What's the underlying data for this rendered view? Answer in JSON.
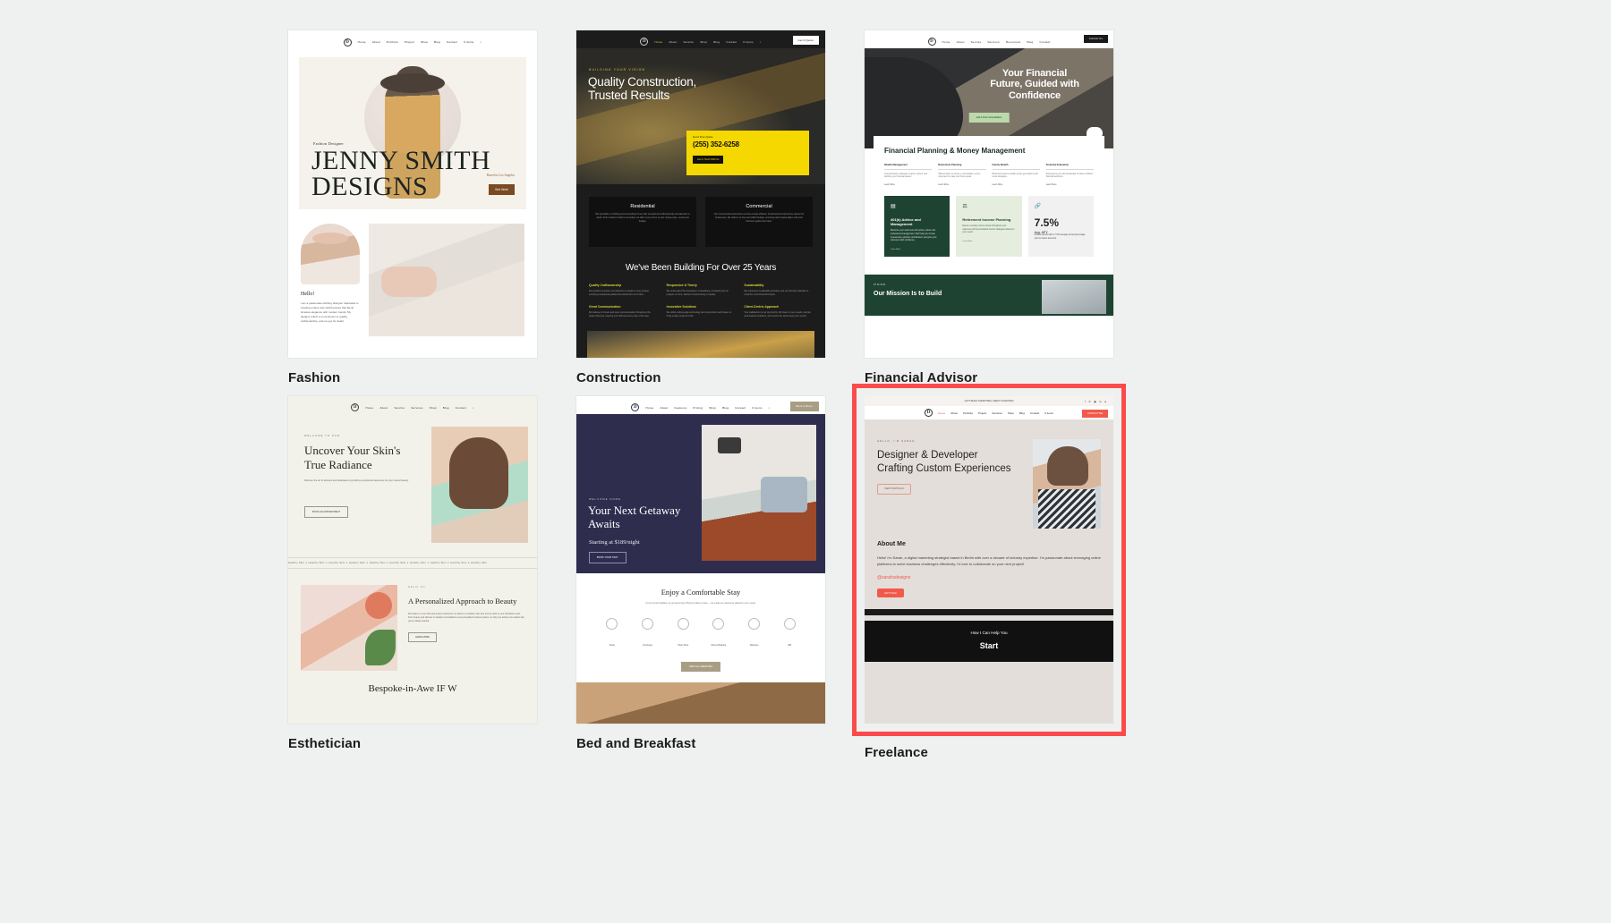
{
  "page": {
    "background": "#eff0f0",
    "highlight_color": "#fb4b4b"
  },
  "cards": [
    {
      "label": "Fashion",
      "nav": {
        "logo": "D",
        "items": [
          "Home",
          "About",
          "Portfolio",
          "Project",
          "Shop",
          "Blog",
          "Contact"
        ],
        "cart": "0 items",
        "search": "search-icon"
      },
      "hero": {
        "eyebrow": "Fashion Designer",
        "title_line1": "JENNY SMITH",
        "title_line2": "DESIGNS",
        "location": "Based in Los Angeles",
        "button": "See Work"
      },
      "about": {
        "heading": "Hello!",
        "body": "I am a passionate clothing designer dedicated to creating unique and stylish pieces that blend timeless elegance with modern trends. My designs reflect a commitment to quality, craftsmanship, and an eye for detail."
      }
    },
    {
      "label": "Construction",
      "nav": {
        "logo": "D",
        "items": [
          "Home",
          "About",
          "Service",
          "Shop",
          "Blog",
          "Contact"
        ],
        "cart": "0 items",
        "quote_button": "Get A Quote"
      },
      "hero": {
        "eyebrow": "BUILDING YOUR VISION",
        "title_line1": "Quality Construction,",
        "title_line2": "Trusted Results",
        "quote_label": "Get A Free Quote",
        "phone": "(255) 352-6258",
        "cta": "Get In Touch With Us"
      },
      "services": [
        {
          "title": "Residential",
          "body": "We specialize in building and renovating homes with exceptional craftsmanship and attention to detail. From modern builds to remodels, we tailor every home to your unique style, needs and budget."
        },
        {
          "title": "Commercial",
          "body": "Our commercial construction services create efficient, functional and impressive spaces for businesses. We deliver on time and within budget, ensuring each project aligns with your business goals and brand."
        }
      ],
      "years_heading": "We've Been Building For Over 25 Years",
      "features": [
        {
          "title": "Quality Craftsmanship",
          "body": "We prioritize precision and attention to detail in every project, ensuring exceptional quality that stands the test of time."
        },
        {
          "title": "Responsive & Timely",
          "body": "We understand the importance of deadlines, completing all our projects on time, without compromising on quality."
        },
        {
          "title": "Sustainability",
          "body": "We implement sustainable practices and eco friendly materials to minimize environmental impact."
        },
        {
          "title": "Great Communication",
          "body": "We believe in honest and open communication throughout the project lifecycle, keeping you informed every step of the way."
        },
        {
          "title": "Innovative Solutions",
          "body": "We utilize cutting edge technology and construction techniques to bring unique projects to life."
        },
        {
          "title": "Client-Centric Approach",
          "body": "Your satisfaction is our top priority. We listen to your needs, provide personalized solutions, and ensure the work meets your needs."
        }
      ]
    },
    {
      "label": "Financial Advisor",
      "nav": {
        "logo": "D",
        "items": [
          "Home",
          "About",
          "Service",
          "Services",
          "Resources",
          "Blog",
          "Contact"
        ],
        "contact_button": "Contact Us"
      },
      "hero": {
        "title_line1": "Your Financial",
        "title_line2": "Future, Guided with",
        "title_line3": "Confidence",
        "button": "Get A Free Consultation"
      },
      "panel": {
        "title": "Financial Planning & Money Management",
        "columns": [
          {
            "title": "Wealth Management",
            "body": "Comprehensive strategies to grow, protect, and optimize your financial assets.",
            "link": "Learn More"
          },
          {
            "title": "Retirement Planning",
            "body": "Tailored plans to ensure a comfortable, secure retirement to make your future goals.",
            "link": "Learn More"
          },
          {
            "title": "Family Wealth",
            "body": "Build and preserve wealth across generations with smart strategies.",
            "link": "Learn More"
          },
          {
            "title": "Financial Education",
            "body": "Empowering you with knowledge to make confident financial decisions.",
            "link": "Learn More"
          }
        ],
        "tiles": [
          {
            "icon": "document-icon",
            "title": "401(k) Advice and Management",
            "body": "Maximize your retirement with advice, advice and professional management. We'll help you choose investments, optimize contributions, and grow your retirement with confidence.",
            "link": "Learn More"
          },
          {
            "icon": "handshake-icon",
            "title": "Retirement Income Planning",
            "body": "Ensure a steady income stream throughout your retirement with personalized income strategies tailored to your needs.",
            "link": "Learn More"
          },
          {
            "icon": "link-icon",
            "big": "7.5%",
            "sub": "Avg. APY",
            "body": "Achieve growth with a 7.5% average annual percentage yield on select accounts."
          }
        ]
      },
      "footer": {
        "eyebrow": "VISION",
        "heading": "Our Mission Is to Build"
      }
    },
    {
      "label": "Esthetician",
      "nav": {
        "logo": "D",
        "items": [
          "Home",
          "About",
          "Service",
          "Services",
          "Shop",
          "Blog",
          "Contact"
        ],
        "search": "search-icon"
      },
      "hero": {
        "eyebrow": "WELCOME TO OUR",
        "title": "Uncover Your Skin's True Radiance",
        "body": "Discover the art of skincare and dedicated to providing exceptional treatments for your natural beauty.",
        "button": "BOOK AN APPOINTMENT"
      },
      "marquee": "Healthy Skin  ✦  Healthy Skin  ✦  Healthy Skin  ✦  Healthy Skin  ✦  Healthy Skin  ✦  Healthy Skin  ✦  Healthy Skin  ✦  Healthy Skin  ✦  Healthy Skin  ✦  Healthy Skin",
      "section": {
        "eyebrow": "About Us",
        "title": "A Personalized Approach to Beauty",
        "body": "We believe in more than just beauty treatments; we believe in healthier skin care and we tailor to your individual needs. From beauty and skincare to detailed consultations and personalized treatment plans, we help you achieve the radiant skin you've always wanted.",
        "button": "LEARN MORE"
      },
      "last_heading": "Bespoke-in-Awe  IF W"
    },
    {
      "label": "Bed and Breakfast",
      "nav": {
        "logo": "D",
        "items": [
          "Home",
          "About",
          "Features",
          "Pricing",
          "Shop",
          "Blog",
          "Contact"
        ],
        "cart": "0 items",
        "book_button": "Book A Room"
      },
      "hero": {
        "eyebrow": "WELCOME HOME",
        "title_line1": "Your Next Getaway",
        "title_line2": "Awaits",
        "subtitle": "Starting at $189/night",
        "button": "BOOK YOUR STAY"
      },
      "section": {
        "title": "Enjoy a Comfortable Stay",
        "body": "At our bed & breakfast, we go beyond just offering a place to stay — we create an experience tailored to your needs.",
        "amenities": [
          "Study",
          "Concierge",
          "Hotel Tours",
          "Dinner Booking",
          "Wellness",
          "Wifi"
        ],
        "button": "VIEW ALL AMENITIES"
      }
    },
    {
      "label": "Freelance",
      "highlighted": true,
      "topbar": {
        "message": "LET'S BUILD SOMETHING GREAT TOGETHER!",
        "socials": [
          "facebook-icon",
          "x-icon",
          "instagram-icon",
          "linkedin-icon",
          "dribbble-icon"
        ]
      },
      "nav": {
        "logo": "D",
        "items": [
          "Home",
          "About",
          "Portfolio",
          "Project",
          "Services",
          "Shop",
          "Blog",
          "Contact"
        ],
        "cart": "0 items",
        "cta_button": "CONTACT ME"
      },
      "hero": {
        "eyebrow": "HELLO, I'M SARAH",
        "title": "Designer & Developer Crafting Custom Experiences",
        "button": "VIEW PORTFOLIO"
      },
      "about": {
        "heading": "About Me",
        "body": "Hello! I'm Sarah, a digital marketing strategist based in Berlin with over a decade of industry expertise. I'm passionate about leveraging online platforms to solve business challenges effectively. I'd love to collaborate on your next project!",
        "handle": "@sarahsdesigns",
        "button": "LET'S TALK"
      },
      "footer": {
        "line1": "How I Can Help You",
        "line2": "Start"
      }
    }
  ]
}
